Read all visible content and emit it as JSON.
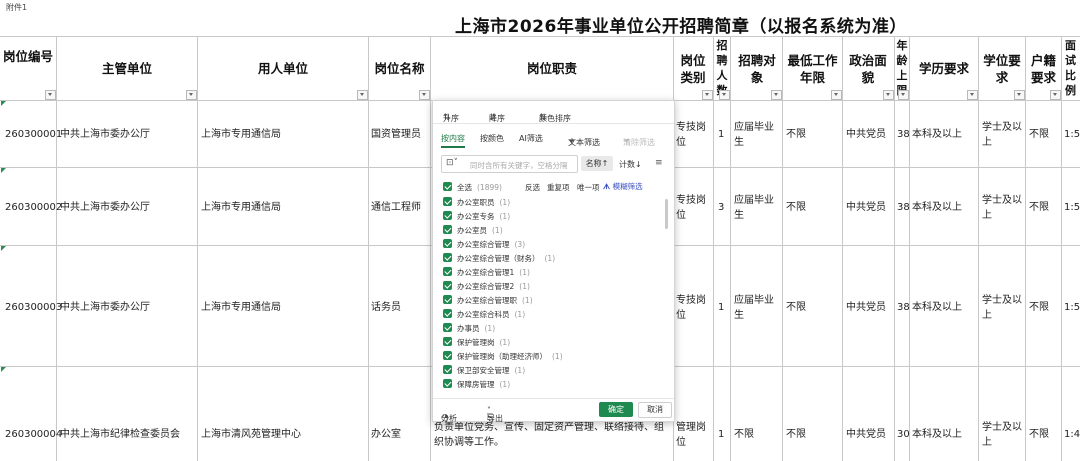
{
  "sheet": {
    "attachment": "附件1",
    "title": "上海市2026年事业单位公开招聘简章（以报名系统为准）",
    "headers": {
      "pos_id": "岗位编号",
      "authority": "主管单位",
      "employer": "用人单位",
      "pos_name": "岗位名称",
      "duty": "岗位职责",
      "pos_type": "岗位类别",
      "hire_count": "招聘人数",
      "target": "招聘对象",
      "min_years": "最低工作年限",
      "political": "政治面貌",
      "age": "年龄上限",
      "education": "学历要求",
      "degree": "学位要求",
      "hukou": "户籍要求",
      "exam_ratio": "面试比例"
    },
    "rows": [
      {
        "pos_id": "260300001",
        "authority": "中共上海市委办公厅",
        "employer": "上海市专用通信局",
        "pos_name": "国资管理员",
        "duty": "",
        "pos_type": "专技岗位",
        "hire_count": "1",
        "target": "应届毕业生",
        "min_years": "不限",
        "political": "中共党员",
        "age": "38",
        "education": "本科及以上",
        "degree": "学士及以上",
        "hukou": "不限",
        "exam_ratio": "1:5"
      },
      {
        "pos_id": "260300002",
        "authority": "中共上海市委办公厅",
        "employer": "上海市专用通信局",
        "pos_name": "通信工程师",
        "duty": "",
        "pos_type": "专技岗位",
        "hire_count": "3",
        "target": "应届毕业生",
        "min_years": "不限",
        "political": "中共党员",
        "age": "38",
        "education": "本科及以上",
        "degree": "学士及以上",
        "hukou": "不限",
        "exam_ratio": "1:5"
      },
      {
        "pos_id": "260300003",
        "authority": "中共上海市委办公厅",
        "employer": "上海市专用通信局",
        "pos_name": "话务员",
        "duty": "",
        "pos_type": "专技岗位",
        "hire_count": "1",
        "target": "应届毕业生",
        "min_years": "不限",
        "political": "中共党员",
        "age": "38",
        "education": "本科及以上",
        "degree": "学士及以上",
        "hukou": "不限",
        "exam_ratio": "1:5"
      },
      {
        "pos_id": "260300004",
        "authority": "中共上海市纪律检查委员会",
        "employer": "上海市清风苑管理中心",
        "pos_name": "办公室",
        "duty": "负责单位党务、宣传、固定资产管理、联络接待、组织协调等工作。",
        "pos_type": "管理岗位",
        "hire_count": "1",
        "target": "不限",
        "min_years": "不限",
        "political": "中共党员",
        "age": "30",
        "education": "本科及以上",
        "degree": "学士及以上",
        "hukou": "不限",
        "exam_ratio": "1:4"
      }
    ]
  },
  "filter_popup": {
    "sort_asc": "升序",
    "sort_desc": "降序",
    "sort_color": "颜色排序",
    "tab_content": "按内容",
    "tab_color": "按颜色",
    "tab_ai": "AI筛选",
    "text_filter": "文本筛选",
    "clear_filter": "清除筛选",
    "search_placeholder": "同时含所有关键字，空格分隔",
    "sort_by_name": "名称↑",
    "sort_by_count": "计数↓",
    "select_all": "全选",
    "select_all_count": "(1899)",
    "invert": "反选",
    "duplicates": "重复项",
    "unique": "唯一项",
    "fuzzy": "模糊筛选",
    "items": [
      {
        "label": "办公室职员",
        "count": "(1)"
      },
      {
        "label": "办公室专务",
        "count": "(1)"
      },
      {
        "label": "办公室员",
        "count": "(1)"
      },
      {
        "label": "办公室综合管理",
        "count": "(3)"
      },
      {
        "label": "办公室综合管理（财务）",
        "count": "(1)"
      },
      {
        "label": "办公室综合管理1",
        "count": "(1)"
      },
      {
        "label": "办公室综合管理2",
        "count": "(1)"
      },
      {
        "label": "办公室综合管理职",
        "count": "(1)"
      },
      {
        "label": "办公室综合科员",
        "count": "(1)"
      },
      {
        "label": "办事员",
        "count": "(1)"
      },
      {
        "label": "保护管理岗",
        "count": "(1)"
      },
      {
        "label": "保护管理岗（助理经济师）",
        "count": "(1)"
      },
      {
        "label": "保卫部安全管理",
        "count": "(1)"
      },
      {
        "label": "保障房管理",
        "count": "(1)"
      }
    ],
    "analyze": "分析",
    "export": "导出",
    "ok": "确定",
    "cancel": "取消"
  },
  "colors": {
    "accent": "#1f8a4f",
    "grid": "#c8c8c8",
    "ai": "#3a4fc2"
  }
}
